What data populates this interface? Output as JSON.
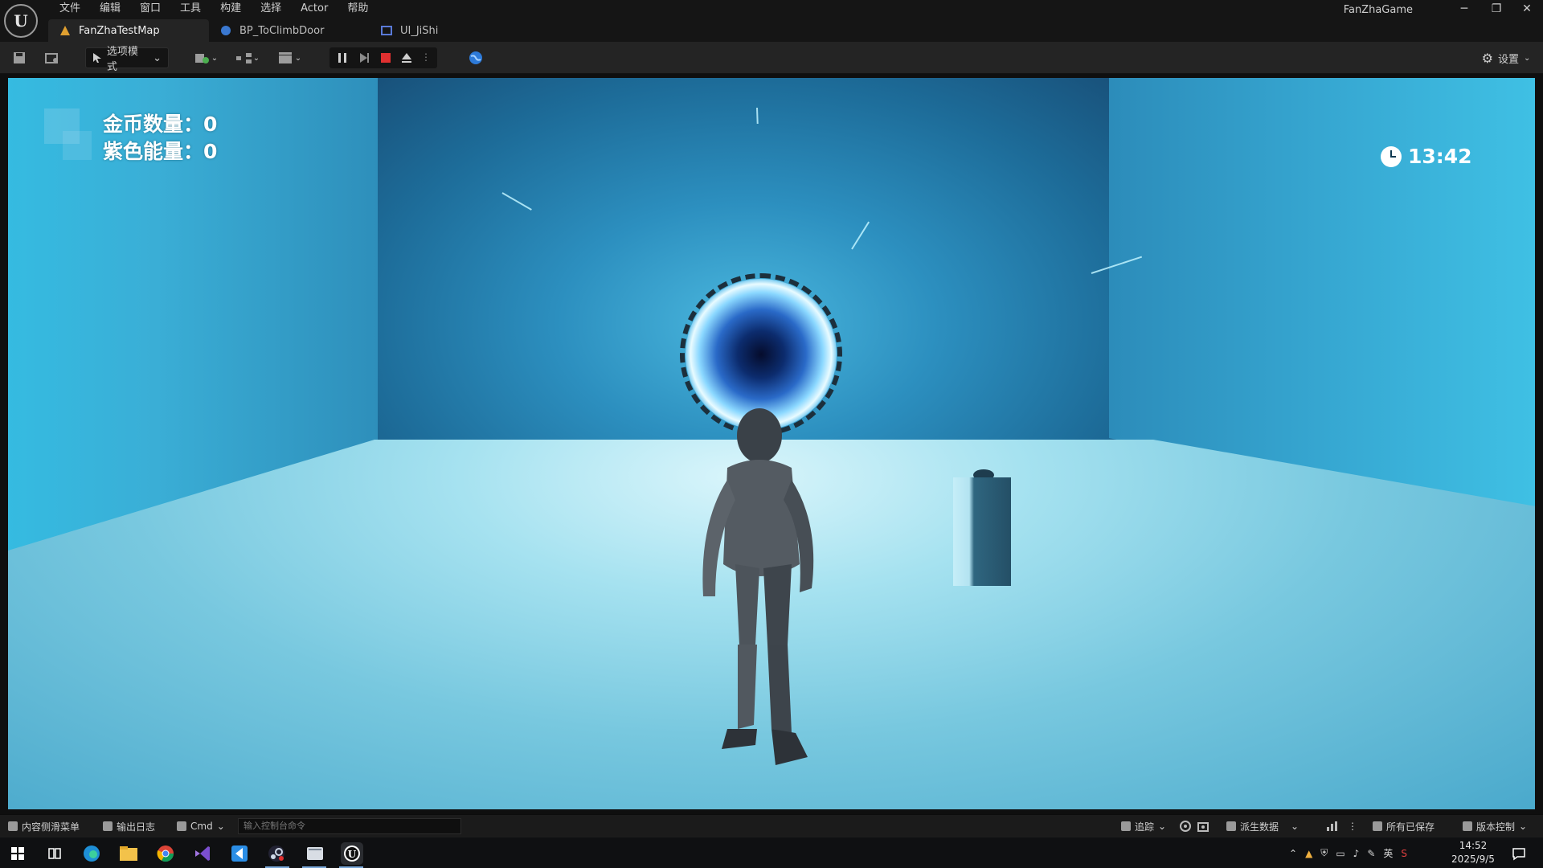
{
  "menubar": {
    "items": [
      "文件",
      "编辑",
      "窗口",
      "工具",
      "构建",
      "选择",
      "Actor",
      "帮助"
    ]
  },
  "window": {
    "project_name": "FanZhaGame",
    "minimize": "─",
    "restore": "❐",
    "close": "✕"
  },
  "tabs": [
    {
      "label": "FanZhaTestMap",
      "icon": "level-icon",
      "color": "#e0a030"
    },
    {
      "label": "BP_ToClimbDoor",
      "icon": "blueprint-icon",
      "color": "#3a78d0"
    },
    {
      "label": "UI_JiShi",
      "icon": "widget-icon",
      "color": "#5a7ad8"
    }
  ],
  "toolbar": {
    "mode_label": "选项模式",
    "settings_label": "设置",
    "stop_color": "#e03030"
  },
  "hud": {
    "coins_label": "金币数量：0",
    "energy_label": "紫色能量：0",
    "time": "13:42"
  },
  "statusbar": {
    "content_drawer": "内容侧滑菜单",
    "output_log": "输出日志",
    "cmd_label": "Cmd",
    "console_placeholder": "输入控制台命令",
    "trace": "追踪",
    "derived_data": "派生数据",
    "all_saved": "所有已保存",
    "source_control": "版本控制"
  },
  "taskbar": {
    "icons": [
      "windows-start-icon",
      "task-view-icon",
      "edge-icon",
      "file-explorer-icon",
      "chrome-icon",
      "visual-studio-icon",
      "vscode-icon",
      "steam-icon",
      "app-icon",
      "unreal-engine-icon"
    ],
    "tray_lang": "英",
    "time": "14:52",
    "date": "2025/9/5"
  }
}
